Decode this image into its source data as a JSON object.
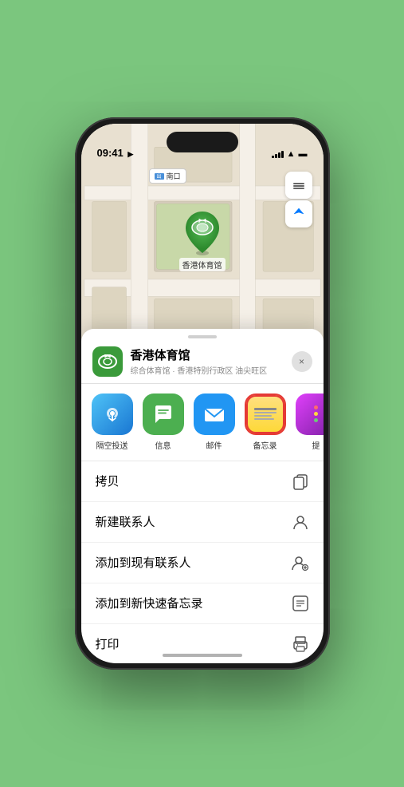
{
  "status": {
    "time": "09:41",
    "time_arrow": "▶",
    "signal": "signal",
    "wifi": "wifi",
    "battery": "battery"
  },
  "map": {
    "label_text": "南口",
    "label_prefix": "出",
    "marker_name": "香港体育馆",
    "control_layers": "⊞",
    "control_location": "⊕"
  },
  "location_card": {
    "name": "香港体育馆",
    "subtitle": "综合体育馆 · 香港特别行政区 油尖旺区",
    "close_label": "×"
  },
  "share_items": [
    {
      "id": "airdrop",
      "label": "隔空投送",
      "type": "airdrop"
    },
    {
      "id": "messages",
      "label": "信息",
      "type": "messages"
    },
    {
      "id": "mail",
      "label": "邮件",
      "type": "mail"
    },
    {
      "id": "notes",
      "label": "备忘录",
      "type": "notes"
    },
    {
      "id": "more",
      "label": "提",
      "type": "more"
    }
  ],
  "actions": [
    {
      "label": "拷贝",
      "icon": "copy"
    },
    {
      "label": "新建联系人",
      "icon": "person"
    },
    {
      "label": "添加到现有联系人",
      "icon": "person-add"
    },
    {
      "label": "添加到新快速备忘录",
      "icon": "note"
    },
    {
      "label": "打印",
      "icon": "print"
    }
  ]
}
